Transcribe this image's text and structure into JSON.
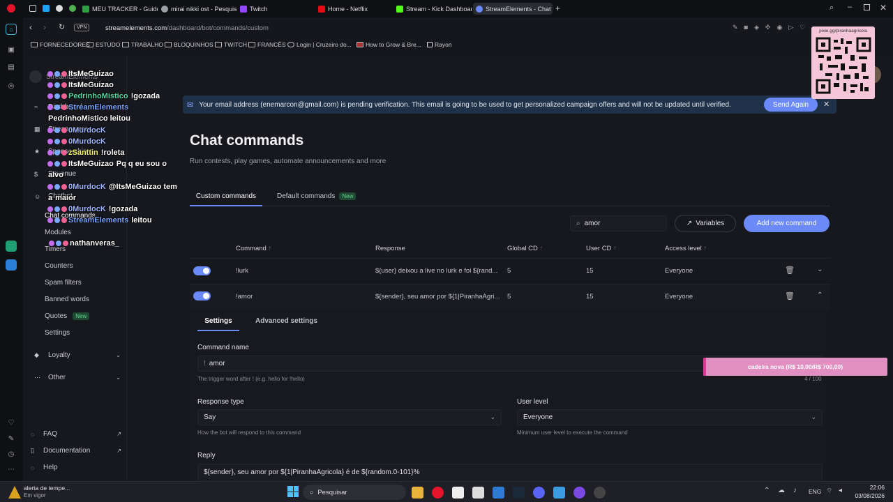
{
  "tabs": [
    {
      "label": "MEU TRACKER - Guides b",
      "color": "#2ea043"
    },
    {
      "label": "mirai nikki ost - Pesquisa",
      "color": "#9aa0a6"
    },
    {
      "label": "Twitch",
      "color": "#9146ff"
    },
    {
      "label": "Home - Netflix",
      "color": "#e50914"
    },
    {
      "label": "Stream - Kick Dashboard",
      "color": "#53fc18"
    },
    {
      "label": "StreamElements - Chat co",
      "color": "#6b8af8"
    }
  ],
  "address": {
    "vpn": "VPN",
    "host": "streamelements.com",
    "path": "/dashboard/bot/commands/custom"
  },
  "bookmarks": [
    "FORNECEDORES",
    "ESTUDO",
    "TRABALHO",
    "BLOQUINHOS",
    "TWITCH",
    "FRANCÊS",
    "Login | Cruzeiro do...",
    "How to Grow & Bre...",
    "Rayon"
  ],
  "sidebar": {
    "brand": "StreamElements",
    "items": [
      "Dashboard",
      "Stream store",
      "Sponsorships",
      "Revenue",
      "Chatbot"
    ],
    "chatbot_sub": [
      "Chat commands",
      "Modules",
      "Timers",
      "Counters",
      "Spam filters",
      "Banned words",
      "Quotes",
      "Settings"
    ],
    "quotes_badge": "New",
    "loyalty": "Loyalty",
    "other": "Other",
    "footer": [
      "FAQ",
      "Documentation",
      "Help"
    ]
  },
  "banner": {
    "text": "Your email address (enemarcon@gmail.com) is pending verification. This email is going to be used to get personalized campaign offers and will not be updated until verified.",
    "button": "Send Again"
  },
  "page": {
    "title": "Chat commands",
    "subtitle": "Run contests, play games, automate announcements and more",
    "tabs": [
      "Custom commands",
      "Default commands"
    ],
    "default_badge": "New",
    "search_value": "amor",
    "variables": "Variables",
    "add_new": "Add new command"
  },
  "table": {
    "headers": [
      "Command",
      "Response",
      "Global CD",
      "User CD",
      "Access level"
    ],
    "rows": [
      {
        "command": "!lurk",
        "response": "${user} deixou a live no lurk e foi ${rand...",
        "global": "5",
        "user": "15",
        "access": "Everyone"
      },
      {
        "command": "!amor",
        "response": "${sender}, seu amor por ${1|PiranhaAgri...",
        "global": "5",
        "user": "15",
        "access": "Everyone"
      }
    ]
  },
  "editor": {
    "tabs": [
      "Settings",
      "Advanced settings"
    ],
    "command_name_label": "Command name",
    "prefix": "!",
    "command_name": "amor",
    "command_help": "The trigger word after ! (e.g. hello for !hello)",
    "counter": "4 / 100",
    "response_type_label": "Response type",
    "response_type": "Say",
    "response_help": "How the bot will respond to this command",
    "user_level_label": "User level",
    "user_level": "Everyone",
    "user_level_help": "Minimum user level to execute the command",
    "reply_label": "Reply",
    "reply": "${sender}, seu amor por ${1|PiranhaAgricola} é de ${random.0-101}%"
  },
  "overlay": {
    "chat": [
      {
        "name": "ItsMeGuizao",
        "msg": "",
        "color": "#ffffff"
      },
      {
        "name": "ItsMeGuizao",
        "msg": "",
        "color": "#ffffff"
      },
      {
        "name": "PedrinhoMistico",
        "msg": "!gozada",
        "color": "#57d9a3"
      },
      {
        "name": "StreamElements",
        "msg": "",
        "color": "#7aa7ff"
      },
      {
        "name": "PedrinhoMistico leitou",
        "msg": "",
        "color": "#ffffff"
      },
      {
        "name": "0MurdocK",
        "msg": "",
        "color": "#9db4ff"
      },
      {
        "name": "0MurdocK",
        "msg": "",
        "color": "#9db4ff"
      },
      {
        "name": "zSanttin",
        "msg": "!roleta",
        "color": "#f0f06a"
      },
      {
        "name": "ItsMeGuizao",
        "msg": "Pq q eu sou o",
        "color": "#ffffff"
      },
      {
        "name": "alvo",
        "msg": "",
        "color": "#ffffff"
      },
      {
        "name": "0MurdocK",
        "msg": "@ItsMeGuizao tem",
        "color": "#9db4ff"
      },
      {
        "name": "a",
        "msg": "maior",
        "color": "#ffffff"
      },
      {
        "name": "0MurdocK",
        "msg": "!gozada",
        "color": "#9db4ff"
      },
      {
        "name": "StreamElements",
        "msg": "leitou",
        "color": "#7aa7ff"
      },
      {
        "name": "nathanveras_",
        "msg": "",
        "color": "#ffffff"
      }
    ],
    "qr_label": "pixie.gg/piranhaagricola",
    "goal": "cadeira nova (R$ 10,00/R$ 700,00)",
    "goal_progress": 0.014
  },
  "taskbar": {
    "alert_title": "alerta de tempe...",
    "alert_sub": "Em vigor",
    "search": "Pesquisar",
    "lang": "ENG",
    "time": "22:06",
    "date": "03/08/2026"
  }
}
